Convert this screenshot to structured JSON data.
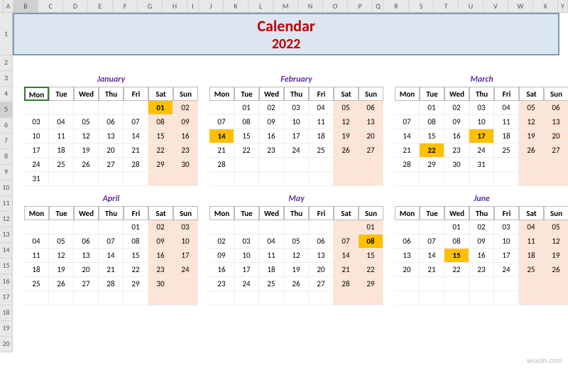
{
  "columns": [
    "A",
    "B",
    "C",
    "D",
    "E",
    "F",
    "G",
    "H",
    "I",
    "J",
    "K",
    "L",
    "M",
    "N",
    "O",
    "P",
    "Q",
    "R",
    "S",
    "T",
    "U",
    "V",
    "W",
    "X",
    "Y"
  ],
  "rows": [
    "1",
    "2",
    "3",
    "4",
    "5",
    "6",
    "7",
    "8",
    "9",
    "10",
    "11",
    "12",
    "13",
    "14",
    "15",
    "16",
    "17",
    "18",
    "19",
    "20"
  ],
  "selected_cell": "B5",
  "banner": {
    "title": "Calendar",
    "year": "2022"
  },
  "day_names": [
    "Mon",
    "Tue",
    "Wed",
    "Thu",
    "Fri",
    "Sat",
    "Sun"
  ],
  "months_row1": [
    {
      "name": "January",
      "weeks": [
        [
          "",
          "",
          "",
          "",
          "",
          "01",
          "02"
        ],
        [
          "03",
          "04",
          "05",
          "06",
          "07",
          "08",
          "09"
        ],
        [
          "10",
          "11",
          "12",
          "13",
          "14",
          "15",
          "16"
        ],
        [
          "17",
          "18",
          "19",
          "20",
          "21",
          "22",
          "23"
        ],
        [
          "24",
          "25",
          "26",
          "27",
          "28",
          "29",
          "30"
        ],
        [
          "31",
          "",
          "",
          "",
          "",
          "",
          ""
        ]
      ],
      "highlights": [
        "01"
      ]
    },
    {
      "name": "February",
      "weeks": [
        [
          "",
          "01",
          "02",
          "03",
          "04",
          "05",
          "06"
        ],
        [
          "07",
          "08",
          "09",
          "10",
          "11",
          "12",
          "13"
        ],
        [
          "14",
          "15",
          "16",
          "17",
          "18",
          "19",
          "20"
        ],
        [
          "21",
          "22",
          "23",
          "24",
          "25",
          "26",
          "27"
        ],
        [
          "28",
          "",
          "",
          "",
          "",
          "",
          ""
        ],
        [
          "",
          "",
          "",
          "",
          "",
          "",
          ""
        ]
      ],
      "highlights": [
        "14"
      ]
    },
    {
      "name": "March",
      "weeks": [
        [
          "",
          "01",
          "02",
          "03",
          "04",
          "05",
          "06"
        ],
        [
          "07",
          "08",
          "09",
          "10",
          "11",
          "12",
          "13"
        ],
        [
          "14",
          "15",
          "16",
          "17",
          "18",
          "19",
          "20"
        ],
        [
          "21",
          "22",
          "23",
          "24",
          "25",
          "26",
          "27"
        ],
        [
          "28",
          "29",
          "30",
          "31",
          "",
          "",
          ""
        ],
        [
          "",
          "",
          "",
          "",
          "",
          "",
          ""
        ]
      ],
      "highlights": [
        "17",
        "22"
      ]
    }
  ],
  "months_row2": [
    {
      "name": "April",
      "weeks": [
        [
          "",
          "",
          "",
          "",
          "01",
          "02",
          "03"
        ],
        [
          "04",
          "05",
          "06",
          "07",
          "08",
          "09",
          "10"
        ],
        [
          "11",
          "12",
          "13",
          "14",
          "15",
          "16",
          "17"
        ],
        [
          "18",
          "19",
          "20",
          "21",
          "22",
          "23",
          "24"
        ],
        [
          "25",
          "26",
          "27",
          "28",
          "29",
          "30",
          ""
        ],
        [
          "",
          "",
          "",
          "",
          "",
          "",
          ""
        ]
      ],
      "highlights": []
    },
    {
      "name": "May",
      "weeks": [
        [
          "",
          "",
          "",
          "",
          "",
          "",
          "01"
        ],
        [
          "02",
          "03",
          "04",
          "05",
          "06",
          "07",
          "08"
        ],
        [
          "09",
          "10",
          "11",
          "12",
          "13",
          "14",
          "15"
        ],
        [
          "16",
          "17",
          "18",
          "19",
          "20",
          "21",
          "22"
        ],
        [
          "23",
          "24",
          "25",
          "26",
          "27",
          "28",
          "29"
        ],
        [
          "",
          "",
          "",
          "",
          "",
          "",
          ""
        ]
      ],
      "highlights": [
        "08"
      ]
    },
    {
      "name": "June",
      "weeks": [
        [
          "",
          "",
          "01",
          "02",
          "03",
          "04",
          "05"
        ],
        [
          "06",
          "07",
          "08",
          "09",
          "10",
          "11",
          "12"
        ],
        [
          "13",
          "14",
          "15",
          "16",
          "17",
          "18",
          "19"
        ],
        [
          "20",
          "21",
          "22",
          "23",
          "24",
          "25",
          "26"
        ],
        [
          "",
          "",
          "",
          "",
          "",
          "",
          ""
        ],
        [
          "",
          "",
          "",
          "",
          "",
          "",
          ""
        ]
      ],
      "highlights": [
        "15"
      ]
    }
  ],
  "watermark": "wsxdn.com"
}
